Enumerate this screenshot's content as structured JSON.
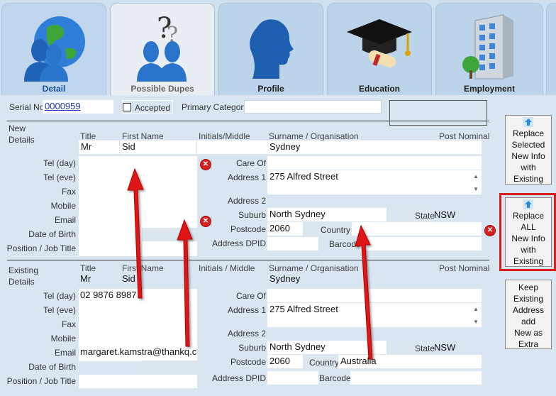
{
  "tabs": [
    {
      "label": "Detail",
      "icon": "globe-people-icon"
    },
    {
      "label": "Possible Dupes",
      "icon": "question-people-icon"
    },
    {
      "label": "Profile",
      "icon": "head-silhouette-icon"
    },
    {
      "label": "Education",
      "icon": "graduation-cap-icon"
    },
    {
      "label": "Employment",
      "icon": "building-icon"
    }
  ],
  "header": {
    "serial_label": "Serial No",
    "serial_value": "0000959",
    "accepted_label": "Accepted",
    "primary_category_label": "Primary Category"
  },
  "columns": {
    "title": "Title",
    "first_name": "First Name",
    "initials_new": "Initials/Middle",
    "initials_existing": "Initials / Middle",
    "surname": "Surname / Organisation",
    "post_nominal": "Post Nominal"
  },
  "labels": {
    "tel_day": "Tel (day)",
    "tel_eve": "Tel (eve)",
    "fax": "Fax",
    "mobile": "Mobile",
    "email": "Email",
    "dob": "Date of Birth",
    "position": "Position / Job Title",
    "care_of": "Care Of",
    "address1": "Address 1",
    "address2": "Address 2",
    "suburb": "Suburb",
    "state": "State",
    "postcode": "Postcode",
    "country": "Country",
    "address_dpid": "Address DPID",
    "barcode": "Barcode"
  },
  "new_details": {
    "section_label_1": "New",
    "section_label_2": "Details",
    "title": "Mr",
    "first_name": "Sid",
    "surname": "Sydney",
    "address1": "275 Alfred Street",
    "suburb": "North Sydney",
    "state": "NSW",
    "postcode": "2060"
  },
  "existing_details": {
    "section_label_1": "Existing",
    "section_label_2": "Details",
    "title": "Mr",
    "first_name": "Sid",
    "surname": "Sydney",
    "tel_day": "02 9876 8987",
    "email": "margaret.kamstra@thankq.co",
    "address1": "275 Alfred Street",
    "suburb": "North Sydney",
    "state": "NSW",
    "postcode": "2060",
    "country": "Australia"
  },
  "side_buttons": {
    "replace_selected": [
      "Replace",
      "Selected",
      "New Info",
      "with",
      "Existing"
    ],
    "replace_all": [
      "Replace",
      "ALL",
      "New Info",
      "with",
      "Existing"
    ],
    "keep_existing": [
      "Keep",
      "Existing",
      "Address",
      "add",
      "New as",
      "Extra"
    ]
  },
  "colors": {
    "background": "#d9e6f2",
    "highlight": "#d81e1e",
    "link": "#1a37b0"
  }
}
